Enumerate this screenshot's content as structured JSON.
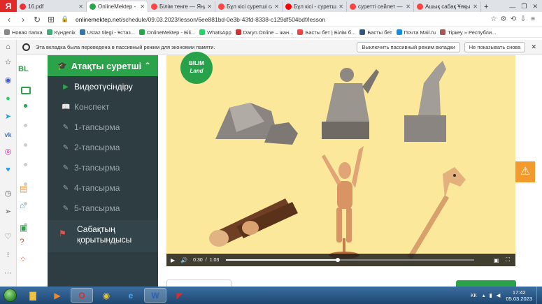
{
  "browser": {
    "tabs": [
      {
        "label": "16.pdf",
        "color": "#e33"
      },
      {
        "label": "OnlineMektep - Біліm",
        "color": "#2aa34a",
        "active": true
      },
      {
        "label": "Білім тенге — Яндекс",
        "color": "#f44"
      },
      {
        "label": "Бұл кісі суретші са...",
        "color": "#f44"
      },
      {
        "label": "Бұл кісі - суретш...",
        "color": "#f00"
      },
      {
        "label": "суретті сейлет — Я...",
        "color": "#f44"
      },
      {
        "label": "Ашық сабақ Ұяқы...",
        "color": "#f44"
      }
    ],
    "new_tab": "+",
    "url_domain": "onlinemektep.net",
    "url_path": "/schedule/09.03.2023/lesson/6ee881bd-0e3b-43fd-8338-c129df504bdf/lesson",
    "bookmarks": [
      {
        "label": "Новая папка",
        "color": "#888"
      },
      {
        "label": "Күнделік",
        "color": "#4a7"
      },
      {
        "label": "Ustaz tilegi - Ұстаз...",
        "color": "#37a"
      },
      {
        "label": "OnlineMektep - Біli...",
        "color": "#2aa34a"
      },
      {
        "label": "WhatsApp",
        "color": "#25d366"
      },
      {
        "label": "Daryn.Online – жан...",
        "color": "#c33"
      },
      {
        "label": "Басты бет | Білім б...",
        "color": "#e44"
      },
      {
        "label": "Басты бет",
        "color": "#357"
      },
      {
        "label": "Почта Mail.ru",
        "color": "#168de2"
      },
      {
        "label": "Тіркеу » Республи...",
        "color": "#a55"
      }
    ],
    "info_text": "Эта вкладка была переведена в пассивный режим для экономии памяти.",
    "info_btn_disable": "Выключить пассивный режим вкладки",
    "info_btn_hide": "Не показывать снова"
  },
  "menu": {
    "title": "Атақты суретші",
    "items": [
      {
        "label": "Видеотүсіндіру",
        "icon": "play-icon"
      },
      {
        "label": "Конспект",
        "icon": "book-icon"
      },
      {
        "label": "1-тапсырма",
        "icon": "edit-icon"
      },
      {
        "label": "2-тапсырма",
        "icon": "edit-icon"
      },
      {
        "label": "3-тапсырма",
        "icon": "edit-icon"
      },
      {
        "label": "4-тапсырма",
        "icon": "edit-icon"
      },
      {
        "label": "5-тапсырма",
        "icon": "edit-icon"
      }
    ],
    "end_label_1": "Сабақтың",
    "end_label_2": "қорытындысы"
  },
  "logo": {
    "line1": "BILIM",
    "line2": "Land"
  },
  "site_logo": "BL",
  "video": {
    "current": "0:30",
    "separator": "/",
    "duration": "1:03",
    "progress": 0.45
  },
  "taskbar": {
    "lang": "КК",
    "time": "17:42",
    "date": "05.03.2023"
  }
}
